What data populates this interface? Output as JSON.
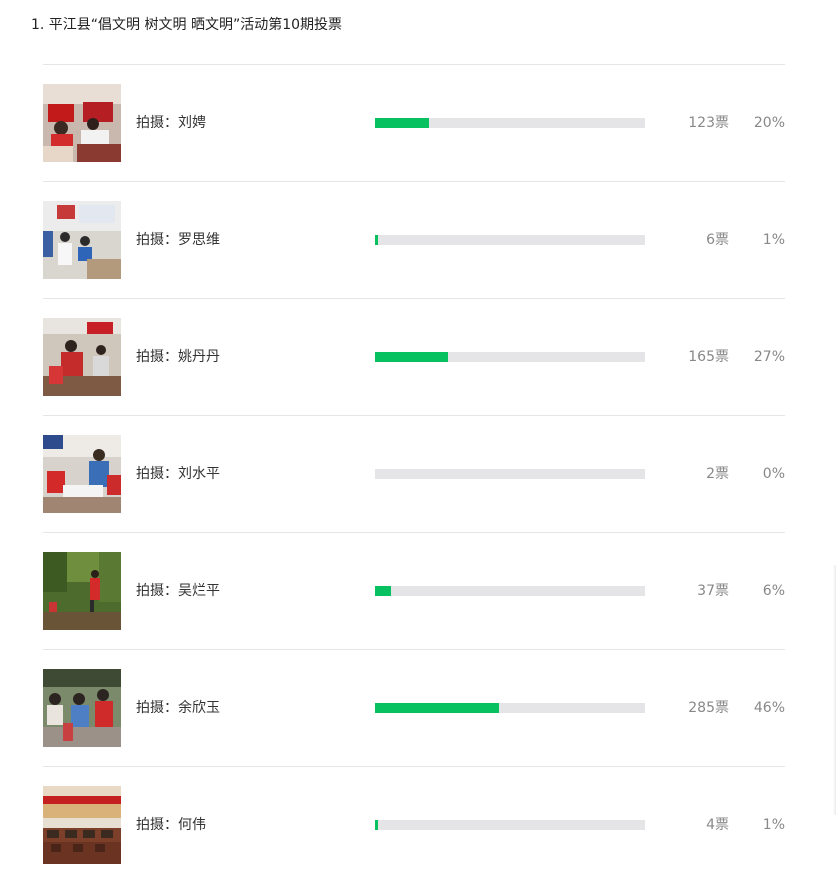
{
  "poll": {
    "title": "1. 平江县“倡文明 树文明 晒文明”活动第10期投票",
    "bar_color": "#07c160",
    "track_color": "#e5e5e7",
    "options": [
      {
        "label": "拍摄：刘娉",
        "votes": "123票",
        "percent": "20%",
        "share": 20,
        "photo": "classroom-photo"
      },
      {
        "label": "拍摄：罗思维",
        "votes": "6票",
        "percent": "1%",
        "share": 1,
        "photo": "office-photo"
      },
      {
        "label": "拍摄：姚丹丹",
        "votes": "165票",
        "percent": "27%",
        "share": 27,
        "photo": "meeting-room-photo"
      },
      {
        "label": "拍摄：刘水平",
        "votes": "2票",
        "percent": "0%",
        "share": 0,
        "photo": "volunteers-photo"
      },
      {
        "label": "拍摄：吴烂平",
        "votes": "37票",
        "percent": "6%",
        "share": 6,
        "photo": "forest-photo"
      },
      {
        "label": "拍摄：余欣玉",
        "votes": "285票",
        "percent": "46%",
        "share": 46,
        "photo": "outdoor-crowd-photo"
      },
      {
        "label": "拍摄：何伟",
        "votes": "4票",
        "percent": "1%",
        "share": 1,
        "photo": "auditorium-photo"
      }
    ]
  }
}
